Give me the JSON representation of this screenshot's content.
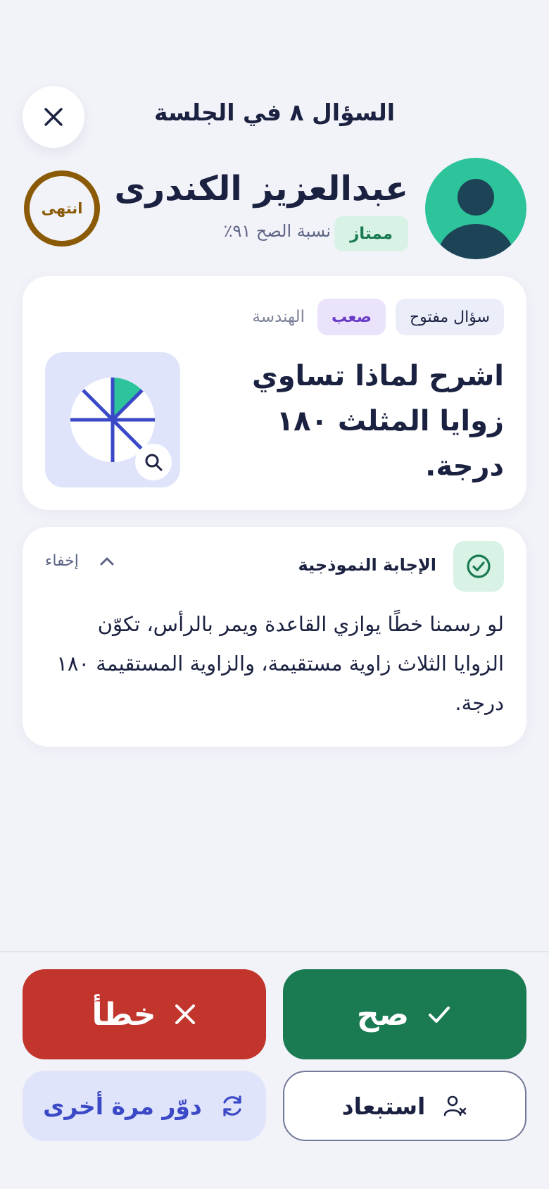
{
  "header": {
    "session_title": "السؤال ٨ في الجلسة",
    "close_icon": "close-icon"
  },
  "student": {
    "name": "عبدالعزيز الكندرى",
    "level_badge": "ممتاز",
    "accuracy": "نسبة الصح ٩١٪",
    "avatar_icon": "user-avatar-icon",
    "timer_label": "انتهى"
  },
  "question": {
    "type_chip": "سؤال مفتوح",
    "difficulty_chip": "صعب",
    "subject": "الهندسة",
    "text": "اشرح لماذا تساوي زوايا المثلث ١٨٠ درجة.",
    "image_icon": "geometry-angles-diagram",
    "zoom_icon": "zoom-icon"
  },
  "answer": {
    "title": "الإجابة النموذجية",
    "hide_label": "إخفاء",
    "text": "لو رسمنا خطًا يوازي القاعدة ويمر بالرأس، تكوّن الزوايا الثلاث زاوية مستقيمة، والزاوية المستقيمة ١٨٠ درجة."
  },
  "actions": {
    "correct_label": "صح",
    "wrong_label": "خطأ",
    "exclude_label": "استبعاد",
    "spin_again_label": "دوّر مرة أخرى"
  },
  "colors": {
    "correct": "#1a7a52",
    "wrong": "#c2352c",
    "accent": "#3b49c7",
    "timer": "#8b5a06",
    "avatar_bg": "#2ec49b"
  }
}
